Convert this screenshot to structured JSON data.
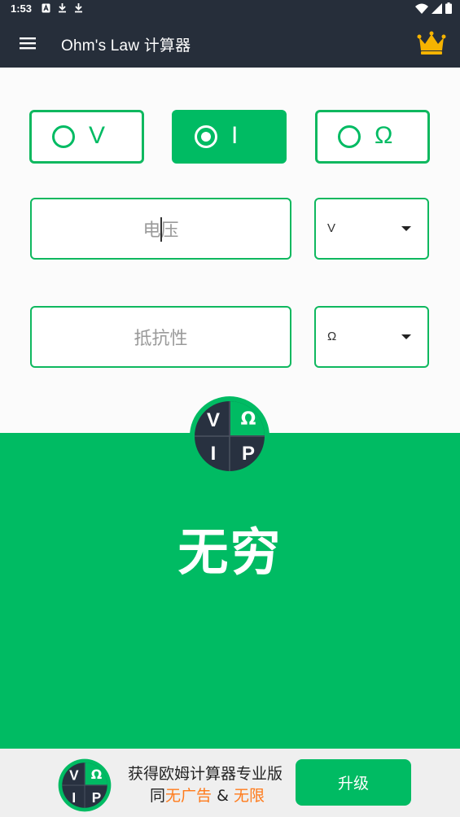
{
  "status_bar": {
    "time": "1:53",
    "icons": [
      "notification-icon",
      "download-icon",
      "download-icon",
      "wifi-icon",
      "signal-icon",
      "battery-icon"
    ]
  },
  "app_bar": {
    "title": "Ohm's Law 计算器",
    "menu_icon": "menu-icon",
    "premium_icon": "crown-icon"
  },
  "mode_selector": {
    "options": [
      {
        "label": "V",
        "selected": false
      },
      {
        "label": "I",
        "selected": true
      },
      {
        "label": "Ω",
        "selected": false
      }
    ]
  },
  "inputs": {
    "voltage": {
      "placeholder": "电压",
      "unit": "V"
    },
    "resistance": {
      "placeholder": "抵抗性",
      "unit": "Ω"
    }
  },
  "vip_logo": {
    "cells": [
      "V",
      "Ω",
      "I",
      "P"
    ]
  },
  "result": {
    "text": "无穷"
  },
  "banner": {
    "line1": "获得欧姆计算器专业版",
    "line2_prefix": "同",
    "line2_no_ads": "无广告",
    "line2_amp": "&",
    "line2_unlimited": "无限",
    "upgrade_label": "升级"
  },
  "colors": {
    "accent": "#00bb63",
    "appbar": "#262e3a",
    "crown": "#f5b301",
    "highlight": "#ff7a1a"
  }
}
